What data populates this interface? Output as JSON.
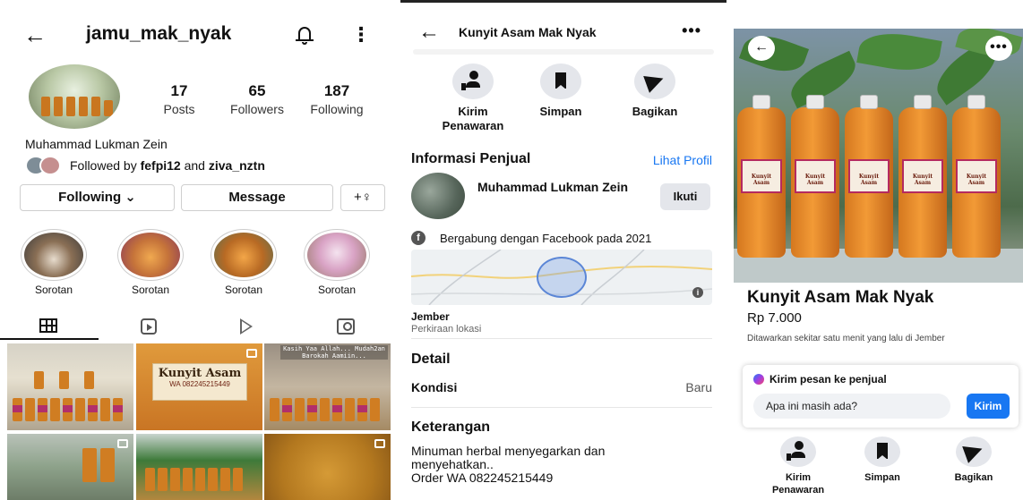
{
  "instagram": {
    "username": "jamu_mak_nyak",
    "stats": [
      {
        "value": "17",
        "label": "Posts"
      },
      {
        "value": "65",
        "label": "Followers"
      },
      {
        "value": "187",
        "label": "Following"
      }
    ],
    "full_name": "Muhammad Lukman Zein",
    "followed_by_prefix": "Followed by ",
    "followed_by_user1": "fefpi12",
    "followed_by_and": " and ",
    "followed_by_user2": "ziva_nztn",
    "buttons": {
      "following": "Following ⌄",
      "message": "Message",
      "add_user": "+♀"
    },
    "highlights": [
      "Sorotan",
      "Sorotan",
      "Sorotan",
      "Sorotan"
    ],
    "grid_label_title": "Kunyit Asam",
    "grid_label_phone": "WA 082245215449",
    "grid_overlay_text": "Kasih Yaa Allah... Mudah2an Barokah Aamiin..."
  },
  "fb_info": {
    "title": "Kunyit Asam Mak Nyak",
    "actions": [
      {
        "label": "Kirim\nPenawaran",
        "icon": "person-offer-icon"
      },
      {
        "label": "Simpan",
        "icon": "bookmark-icon"
      },
      {
        "label": "Bagikan",
        "icon": "share-icon"
      }
    ],
    "seller_section": "Informasi Penjual",
    "view_profile": "Lihat Profil",
    "seller_name": "Muhammad Lukman Zein",
    "follow": "Ikuti",
    "joined": "Bergabung dengan Facebook pada 2021",
    "city": "Jember",
    "city_note": "Perkiraan lokasi",
    "detail_section": "Detail",
    "condition_key": "Kondisi",
    "condition_value": "Baru",
    "description_section": "Keterangan",
    "description_line1": "Minuman herbal menyegarkan dan",
    "description_line2": "menyehatkan..",
    "description_line3": "Order WA 082245215449"
  },
  "fb_product": {
    "title": "Kunyit Asam Mak Nyak",
    "price": "Rp 7.000",
    "meta": "Ditawarkan sekitar satu menit yang lalu di Jember",
    "message_title": "Kirim pesan ke penjual",
    "message_input": "Apa ini masih ada?",
    "send": "Kirim",
    "bottle_label": "Kunyit Asam",
    "actions": [
      {
        "label": "Kirim\nPenawaran",
        "icon": "person-offer-icon"
      },
      {
        "label": "Simpan",
        "icon": "bookmark-icon"
      },
      {
        "label": "Bagikan",
        "icon": "share-icon"
      }
    ]
  },
  "colors": {
    "facebook_blue": "#1877f2",
    "jamu_orange": "#e88a2a"
  }
}
